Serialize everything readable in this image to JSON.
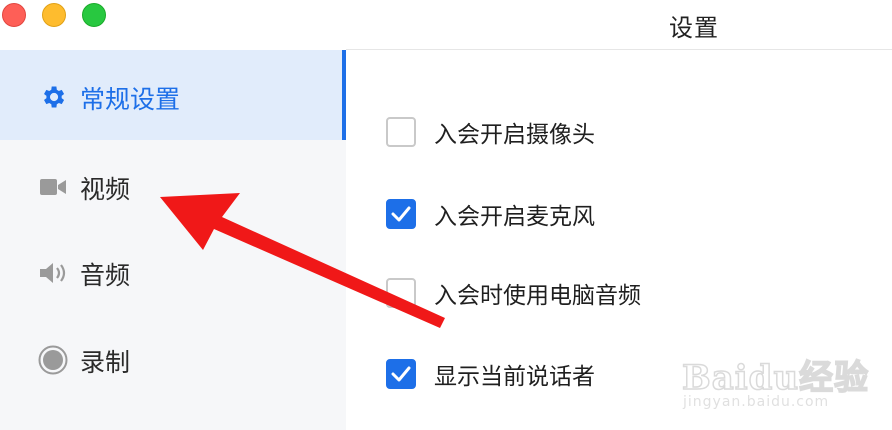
{
  "window": {
    "title": "设置"
  },
  "sidebar": {
    "items": [
      {
        "label": "常规设置",
        "icon": "gear-icon",
        "active": true
      },
      {
        "label": "视频",
        "icon": "video-camera-icon",
        "active": false
      },
      {
        "label": "音频",
        "icon": "speaker-icon",
        "active": false
      },
      {
        "label": "录制",
        "icon": "record-icon",
        "active": false
      }
    ]
  },
  "options": [
    {
      "label": "入会开启摄像头",
      "checked": false
    },
    {
      "label": "入会开启麦克风",
      "checked": true
    },
    {
      "label": "入会时使用电脑音频",
      "checked": false
    },
    {
      "label": "显示当前说话者",
      "checked": true
    }
  ],
  "colors": {
    "accent": "#1d6fe8",
    "sidebar_bg": "#f6f7f9",
    "active_bg": "#e1ecfb",
    "arrow": "#f01818"
  },
  "watermark": {
    "brand": "Baidu经验",
    "url": "jingyan.baidu.com"
  }
}
